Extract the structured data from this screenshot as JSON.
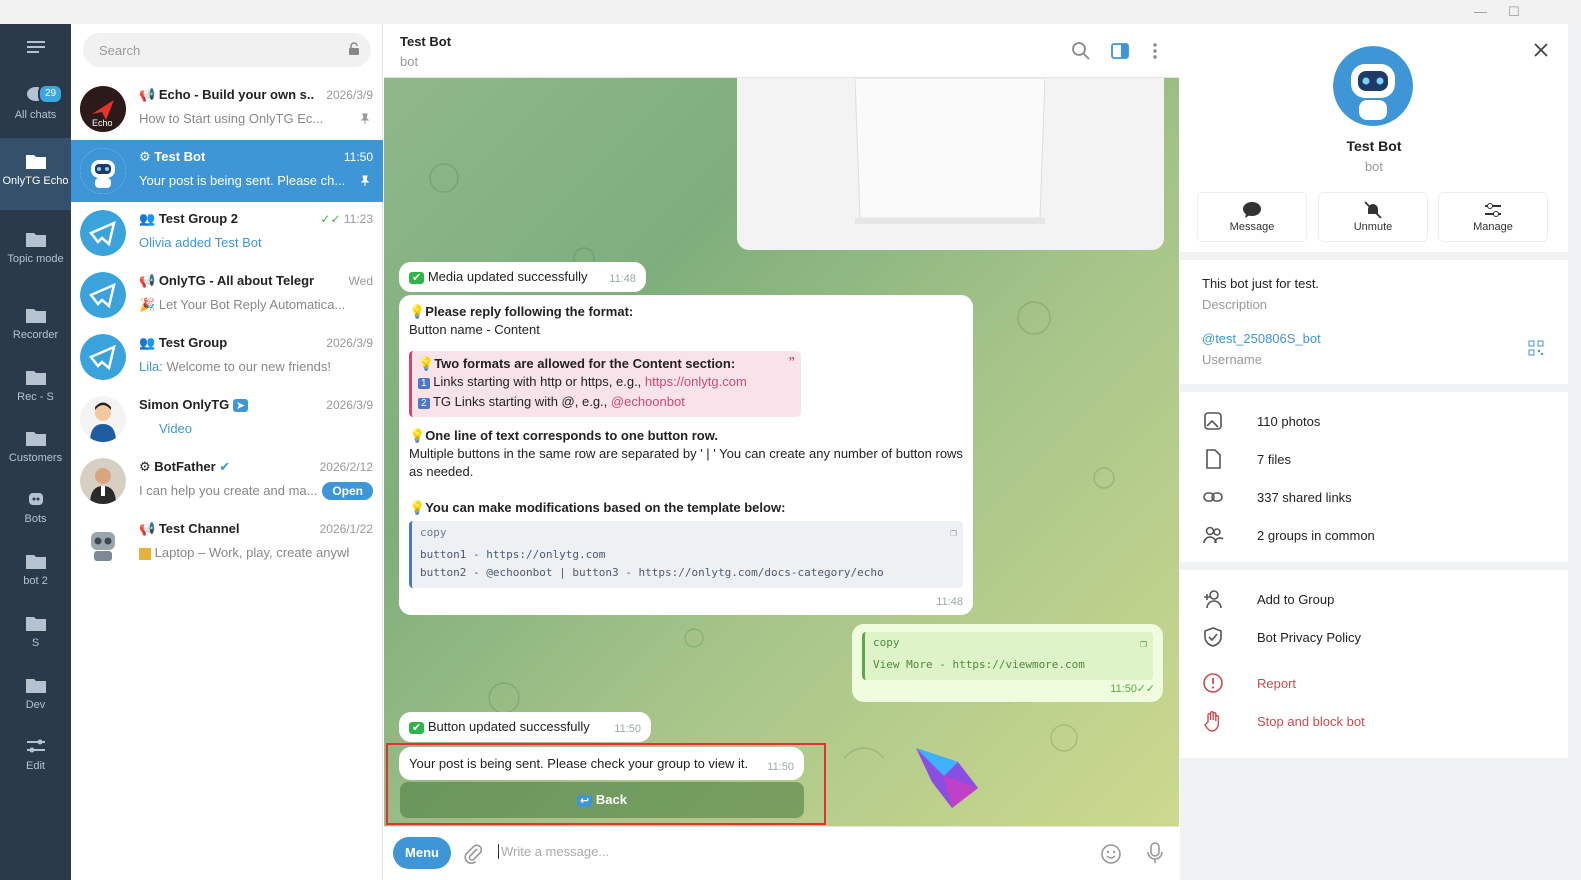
{
  "folders": [
    {
      "label": "All chats",
      "badge": "29"
    },
    {
      "label": "OnlyTG Echo"
    },
    {
      "label": "Topic mode"
    },
    {
      "label": "Recorder"
    },
    {
      "label": "Rec - S"
    },
    {
      "label": "Customers"
    },
    {
      "label": "Bots"
    },
    {
      "label": "bot 2"
    },
    {
      "label": "S"
    },
    {
      "label": "Dev"
    },
    {
      "label": "Edit"
    }
  ],
  "search": {
    "placeholder": "Search"
  },
  "chats": [
    {
      "name": "Echo - Build your own s...",
      "time": "2026/3/9",
      "preview": "How to Start using OnlyTG Ec..."
    },
    {
      "name": "Test Bot",
      "time": "11:50",
      "preview": "Your post is being sent. Please ch..."
    },
    {
      "name": "Test Group 2",
      "time": "11:23",
      "preview": "Olivia added Test Bot"
    },
    {
      "name": "OnlyTG - All about Telegram",
      "time": "Wed",
      "preview": "Let Your Bot Reply Automatica..."
    },
    {
      "name": "Test Group",
      "time": "2026/3/9",
      "preview_sender": "Lila:",
      "preview": "Welcome to our new friends!"
    },
    {
      "name": "Simon OnlyTG",
      "time": "2026/3/9",
      "preview": "Video"
    },
    {
      "name": "BotFather",
      "time": "2026/2/12",
      "preview": "I can help you create and ma...",
      "action": "Open"
    },
    {
      "name": "Test Channel",
      "time": "2026/1/22",
      "preview": "Laptop – Work, play, create anywh..."
    }
  ],
  "header": {
    "title": "Test Bot",
    "subtitle": "bot"
  },
  "messages": {
    "media_updated": {
      "text": "Media updated successfully",
      "time": "11:48"
    },
    "format": {
      "line1": "Please reply following the format:",
      "line2": "Button name - Content",
      "quote_title": "Two formats are allowed for the Content section:",
      "quote_l1_pre": "Links starting with http or https, e.g., ",
      "quote_l1_link": "https://onlytg.com",
      "quote_l2_pre": "TG Links starting with @, e.g., ",
      "quote_l2_link": "@echoonbot",
      "p2_title": "One line of text corresponds to one button row.",
      "p2_body": "Multiple buttons in the same row are separated by ' | ' You can create any number of button rows as needed.",
      "p3_title": "You can make modifications based on the template below:",
      "code_label": "copy",
      "code_l1": "button1 - https://onlytg.com",
      "code_l2": "button2 - @echoonbot | button3 - https://onlytg.com/docs-category/echo",
      "time": "11:48"
    },
    "outgoing": {
      "code_label": "copy",
      "code": "View More - https://viewmore.com",
      "time": "11:50"
    },
    "button_updated": {
      "text": "Button updated successfully",
      "time": "11:50"
    },
    "post_sent": {
      "text": "Your post is being sent. Please check your group to view it.",
      "time": "11:50"
    },
    "back_button": "Back"
  },
  "composer": {
    "menu": "Menu",
    "placeholder": "Write a message..."
  },
  "profile": {
    "name": "Test Bot",
    "subtitle": "bot",
    "actions": [
      "Message",
      "Unmute",
      "Manage"
    ],
    "about": "This bot just for test.",
    "about_label": "Description",
    "username": "@test_250806S_bot",
    "username_label": "Username",
    "media": [
      "110 photos",
      "7 files",
      "337 shared links",
      "2 groups in common"
    ],
    "options": [
      "Add to Group",
      "Bot Privacy Policy"
    ],
    "danger": [
      "Report",
      "Stop and block bot"
    ]
  },
  "colors": {
    "accent": "#3f96d6",
    "sidebar": "#2b3a4b",
    "danger": "#d04a4a"
  }
}
